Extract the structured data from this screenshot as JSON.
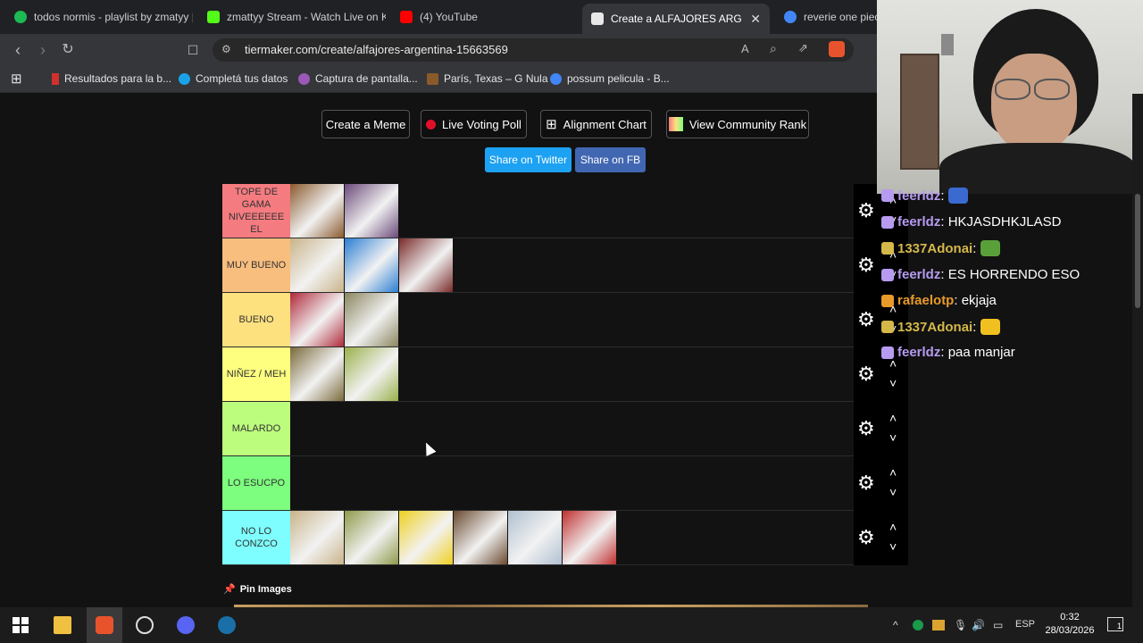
{
  "browser": {
    "tabs": [
      {
        "title": "todos normis - playlist by zmatyy |",
        "color": "#1db954"
      },
      {
        "title": "zmattyy Stream - Watch Live on K",
        "color": "#53fc18"
      },
      {
        "title": "(4) YouTube",
        "color": "#ff0000"
      },
      {
        "title": "Create a ALFAJORES ARGENTI",
        "color": "#e8e8e8"
      },
      {
        "title": "reverie one piec",
        "color": "#4285f4"
      }
    ],
    "url": "tiermaker.com/create/alfajores-argentina-15663569",
    "bookmarks": [
      {
        "label": "Resultados para la b...",
        "color": "#d0312d"
      },
      {
        "label": "Completá tus datos",
        "color": "#1aa3e8"
      },
      {
        "label": "Captura de pantalla...",
        "color": "#9b59b6"
      },
      {
        "label": "París, Texas – G Nula",
        "color": "#8b5a2b"
      },
      {
        "label": "possum pelicula - B...",
        "color": "#4285f4"
      }
    ]
  },
  "toolbar": {
    "create_meme": "Create a Meme",
    "live_poll": "Live Voting Poll",
    "alignment": "Alignment Chart",
    "community": "View Community Rank",
    "share_twitter": "Share on Twitter",
    "share_fb": "Share on FB"
  },
  "tiers": [
    {
      "label": "TOPE DE GAMA NIVEEEEEE EL",
      "color": "#f47b7f",
      "items": [
        "#8a5a2e",
        "#6b4a7a"
      ]
    },
    {
      "label": "MUY BUENO",
      "color": "#f8be7e",
      "items": [
        "#c9b48a",
        "#2b7fd4",
        "#7a2b2b"
      ]
    },
    {
      "label": "BUENO",
      "color": "#fde17f",
      "items": [
        "#b02a3a",
        "#8a8660"
      ]
    },
    {
      "label": "NIÑEZ / MEH",
      "color": "#fefe7f",
      "items": [
        "#7a6a3a",
        "#9ab04a"
      ]
    },
    {
      "label": "MALARDO",
      "color": "#bdfd7e",
      "items": []
    },
    {
      "label": "LO ESUCPO",
      "color": "#7dfe7e",
      "items": []
    },
    {
      "label": "NO LO CONZCO",
      "color": "#7efefe",
      "items": [
        "#c9b48a",
        "#8f9a4a",
        "#f0d020",
        "#6a4a30",
        "#b0c0d0",
        "#c03030"
      ]
    }
  ],
  "pin_images": "Pin Images",
  "chat": [
    {
      "user": "feerldz",
      "message": "",
      "color": "#b69bf0"
    },
    {
      "user": "feerldz",
      "message": "HKJASDHKJLASD",
      "color": "#b69bf0"
    },
    {
      "user": "1337Adonai",
      "message": "",
      "color": "#d4b84a"
    },
    {
      "user": "feerldz",
      "message": "ES HORRENDO ESO",
      "color": "#b69bf0"
    },
    {
      "user": "rafaelotp",
      "message": "ekjaja",
      "color": "#e89a2a"
    },
    {
      "user": "1337Adonai",
      "message": "",
      "color": "#d4b84a"
    },
    {
      "user": "feerldz",
      "message": "paa manjar",
      "color": "#b69bf0"
    }
  ],
  "taskbar": {
    "lang": "ESP",
    "time": "0:32",
    "date": "28/03/2026",
    "notifications": "1"
  }
}
